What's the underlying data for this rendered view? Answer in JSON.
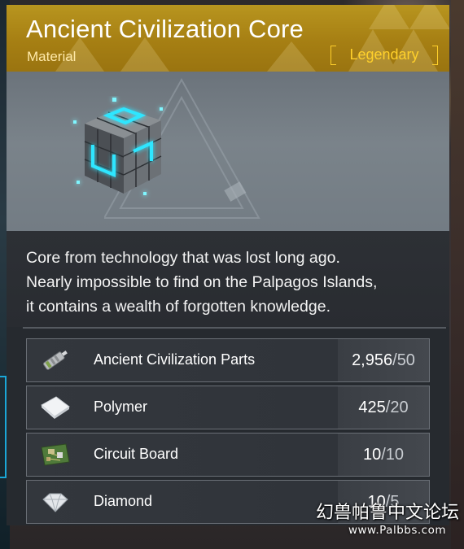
{
  "item": {
    "name": "Ancient Civilization Core",
    "category": "Material",
    "rarity": "Legendary",
    "rarity_color": "#ffd02b",
    "icon": "ancient-core-cube-icon",
    "description_lines": [
      "Core from technology that was lost long ago.",
      "Nearly impossible to find on the Palpagos Islands,",
      "it contains a wealth of forgotten knowledge."
    ]
  },
  "materials": [
    {
      "name": "Ancient Civilization Parts",
      "have": "2,956",
      "need": "50",
      "icon": "ancient-parts-icon"
    },
    {
      "name": "Polymer",
      "have": "425",
      "need": "20",
      "icon": "polymer-icon"
    },
    {
      "name": "Circuit Board",
      "have": "10",
      "need": "10",
      "icon": "circuit-board-icon"
    },
    {
      "name": "Diamond",
      "have": "10",
      "need": "5",
      "icon": "diamond-icon"
    }
  ],
  "watermark": {
    "text": "幻兽帕鲁中文论坛",
    "url": "www.Palbbs.com"
  },
  "colors": {
    "header_gold": "#b8951f",
    "panel_bg": "#262a2f",
    "accent_cyan": "#2fe6ff"
  }
}
